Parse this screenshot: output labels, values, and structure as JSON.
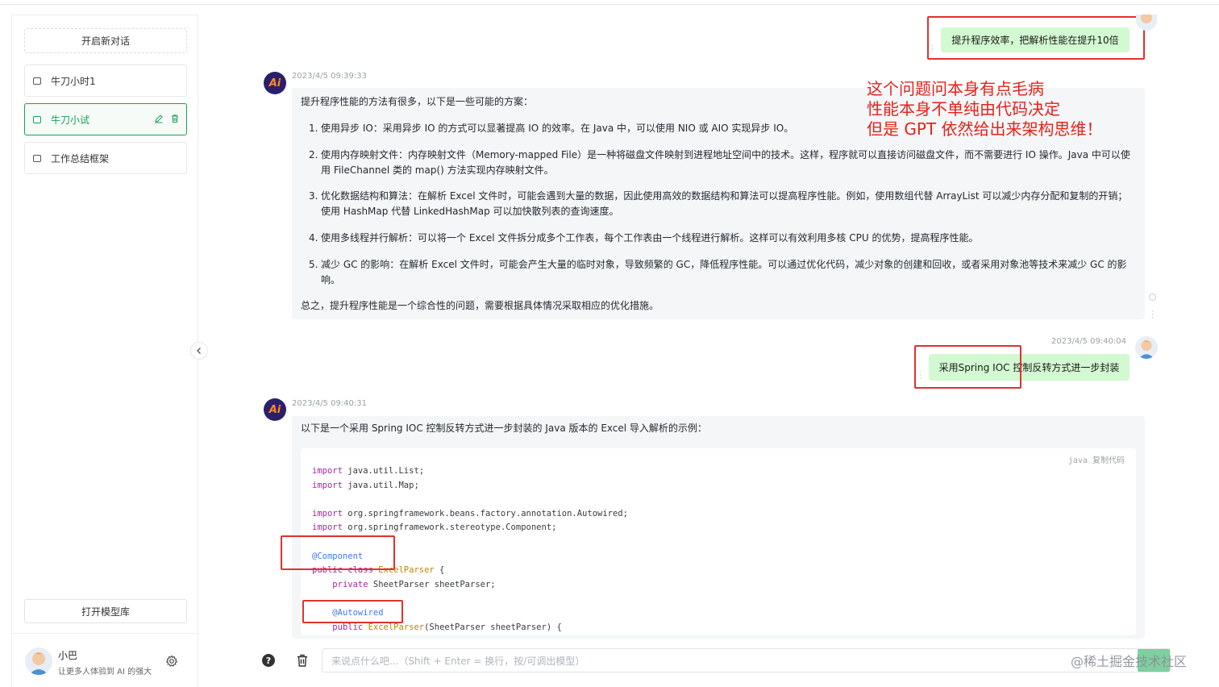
{
  "sidebar": {
    "new_chat": "开启新对话",
    "conversations": [
      {
        "label": "牛刀小时1"
      },
      {
        "label": "牛刀小试"
      },
      {
        "label": "工作总结框架"
      }
    ],
    "model_library": "打开模型库",
    "user": {
      "name": "小巴",
      "description": "让更多人体验到 AI 的强大"
    }
  },
  "chat": {
    "messages": [
      {
        "role": "user",
        "text": "提升程序效率，把解析性能在提升10倍"
      },
      {
        "role": "ai",
        "timestamp": "2023/4/5 09:39:33",
        "intro": "提升程序性能的方法有很多，以下是一些可能的方案：",
        "items": [
          "使用异步 IO：采用异步 IO 的方式可以显著提高 IO 的效率。在 Java 中，可以使用 NIO 或 AIO 实现异步 IO。",
          "使用内存映射文件：内存映射文件（Memory-mapped File）是一种将磁盘文件映射到进程地址空间中的技术。这样，程序就可以直接访问磁盘文件，而不需要进行 IO 操作。Java 中可以使用 FileChannel 类的 map() 方法实现内存映射文件。",
          "优化数据结构和算法：在解析 Excel 文件时，可能会遇到大量的数据，因此使用高效的数据结构和算法可以提高程序性能。例如，使用数组代替 ArrayList 可以减少内存分配和复制的开销；使用 HashMap 代替 LinkedHashMap 可以加快散列表的查询速度。",
          "使用多线程并行解析：可以将一个 Excel 文件拆分成多个工作表，每个工作表由一个线程进行解析。这样可以有效利用多核 CPU 的优势，提高程序性能。",
          "减少 GC 的影响：在解析 Excel 文件时，可能会产生大量的临时对象，导致频繁的 GC，降低程序性能。可以通过优化代码，减少对象的创建和回收，或者采用对象池等技术来减少 GC 的影响。"
        ],
        "item_numbers": [
          "1.",
          "2.",
          "3.",
          "4.",
          "5."
        ],
        "conclusion": "总之，提升程序性能是一个综合性的问题，需要根据具体情况采取相应的优化措施。"
      },
      {
        "role": "user",
        "timestamp": "2023/4/5 09:40:04",
        "text": "采用Spring IOC 控制反转方式进一步封装"
      },
      {
        "role": "ai",
        "timestamp": "2023/4/5 09:40:31",
        "intro": "以下是一个采用 Spring IOC 控制反转方式进一步封装的 Java 版本的 Excel 导入解析的示例：",
        "code_lang": "java",
        "copy_label": "复制代码",
        "code": {
          "l1_kw": "import",
          "l1_rest": " java.util.List;",
          "l2_kw": "import",
          "l2_rest": " java.util.Map;",
          "l3_kw": "import",
          "l3_rest": " org.springframework.beans.factory.annotation.Autowired;",
          "l4_kw": "import",
          "l4_rest": " org.springframework.stereotype.Component;",
          "l5_an": "@Component",
          "l6_kw": "public class",
          "l6_cl": "ExcelParser",
          "l6_rest": " {",
          "l7_kw": "private",
          "l7_rest": " SheetParser sheetParser;",
          "l8_an": "@Autowired",
          "l9_kw": "public",
          "l9_cl": "ExcelParser",
          "l9_rest": "(SheetParser sheetParser) {"
        }
      }
    ]
  },
  "annotation": {
    "line1": "这个问题问本身有点毛病",
    "line2": "性能本身不单纯由代码决定",
    "line3": "但是 GPT 依然给出来架构思维！"
  },
  "input": {
    "placeholder": "来说点什么吧...（Shift + Enter = 换行，按/可调出模型）"
  },
  "watermark": "@稀土掘金技术社区",
  "ai_avatar_text": "Ai",
  "colors": {
    "accent": "#18a058",
    "user_bubble": "#d2f9d1",
    "annotation_red": "#e3231a"
  }
}
